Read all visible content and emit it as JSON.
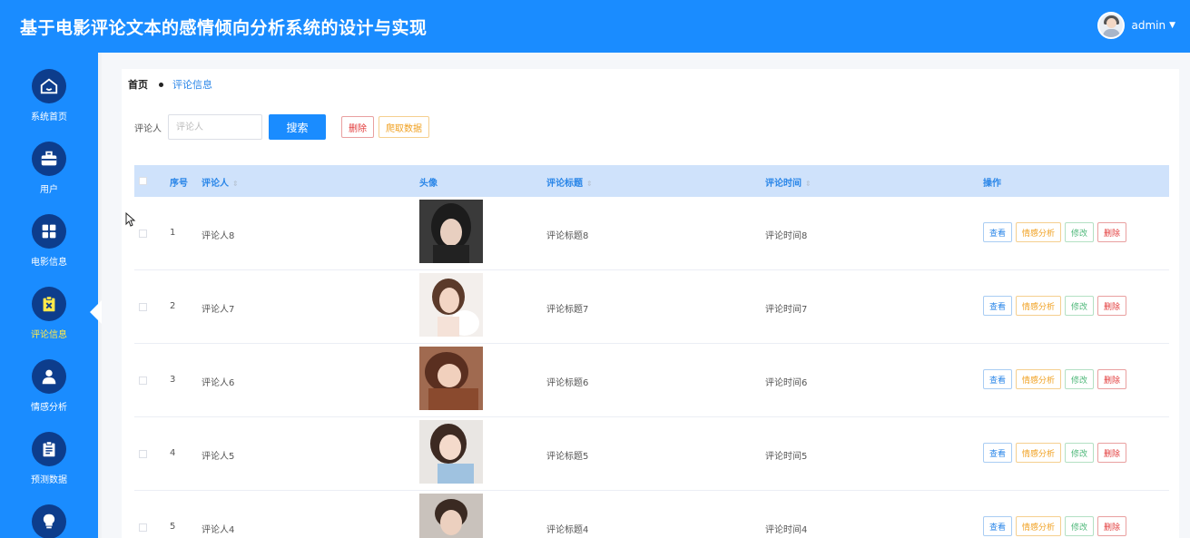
{
  "header": {
    "title": "基于电影评论文本的感情倾向分析系统的设计与实现",
    "username": "admin"
  },
  "sidebar": {
    "items": [
      {
        "label": "系统首页",
        "icon": "home-icon"
      },
      {
        "label": "用户",
        "icon": "briefcase-icon"
      },
      {
        "label": "电影信息",
        "icon": "grid-icon"
      },
      {
        "label": "评论信息",
        "icon": "clipboard-x-icon",
        "active": true
      },
      {
        "label": "情感分析",
        "icon": "user-icon"
      },
      {
        "label": "预测数据",
        "icon": "document-icon"
      },
      {
        "label": "",
        "icon": "lightbulb-icon"
      }
    ]
  },
  "breadcrumb": {
    "home": "首页",
    "current": "评论信息"
  },
  "search": {
    "label": "评论人",
    "placeholder": "评论人",
    "button": "搜索",
    "delete": "删除",
    "crawl": "爬取数据"
  },
  "table": {
    "headers": {
      "index": "序号",
      "reviewer": "评论人",
      "avatar": "头像",
      "title": "评论标题",
      "time": "评论时间",
      "actions": "操作"
    },
    "rows": [
      {
        "index": "1",
        "reviewer": "评论人8",
        "title": "评论标题8",
        "time": "评论时间8"
      },
      {
        "index": "2",
        "reviewer": "评论人7",
        "title": "评论标题7",
        "time": "评论时间7"
      },
      {
        "index": "3",
        "reviewer": "评论人6",
        "title": "评论标题6",
        "time": "评论时间6"
      },
      {
        "index": "4",
        "reviewer": "评论人5",
        "title": "评论标题5",
        "time": "评论时间5"
      },
      {
        "index": "5",
        "reviewer": "评论人4",
        "title": "评论标题4",
        "time": "评论时间4"
      }
    ],
    "row_actions": {
      "view": "查看",
      "emotion": "情感分析",
      "edit": "修改",
      "delete": "删除"
    }
  },
  "colors": {
    "primary": "#1a8cff",
    "sidebar_icon_bg": "#0d3d8c",
    "active_label": "#ffe94a",
    "table_header_bg": "#cfe2fb"
  }
}
